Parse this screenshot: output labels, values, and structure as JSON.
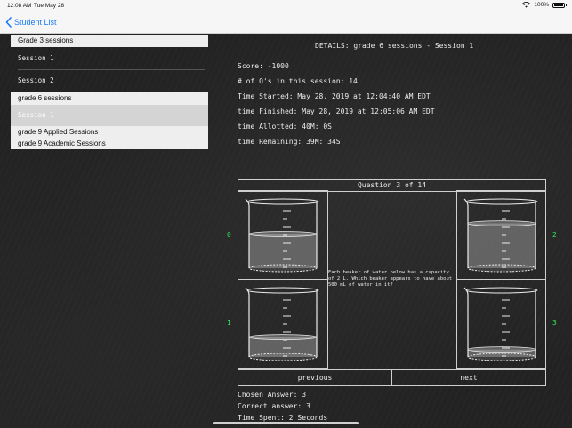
{
  "status": {
    "time": "12:08 AM",
    "date": "Tue May 28",
    "battery": "100%"
  },
  "nav": {
    "back_label": "Student List"
  },
  "sidebar": {
    "items": [
      {
        "label": "Grade 3 sessions",
        "style": "light"
      },
      {
        "label": "Session 1",
        "style": "chalk"
      },
      {
        "label": "Session 2",
        "style": "chalk"
      },
      {
        "label": "grade 6 sessions",
        "style": "light"
      },
      {
        "label": "Session 1",
        "style": "selected"
      },
      {
        "label": "grade 9 Applied Sessions",
        "style": "light"
      },
      {
        "label": "grade 9 Academic Sessions",
        "style": "light"
      }
    ]
  },
  "details": {
    "title": "DETAILS: grade 6 sessions - Session 1",
    "score": "Score: -1000",
    "num_questions": "# of Q's in this session: 14",
    "time_started": "Time Started: May 28, 2019 at 12:04:40 AM EDT",
    "time_finished": "time Finished: May 28, 2019 at 12:05:06 AM EDT",
    "time_allotted": "time Allotted: 40M: 0S",
    "time_remaining": "time Remaining: 39M: 34S"
  },
  "question": {
    "title": "Question 3 of 14",
    "text": "Each beaker of water below has a capacity of 2 L. Which beaker appears to have about 500 mL of water in it?",
    "option_labels": [
      "0",
      "1",
      "2",
      "3"
    ],
    "option_levels": [
      0.55,
      0.32,
      0.72,
      0.12
    ],
    "previous_label": "previous",
    "next_label": "next"
  },
  "result": {
    "chosen": "Chosen Answer: 3",
    "correct": "Correct answer: 3",
    "time_spent": "Time Spent: 2 Seconds"
  },
  "colors": {
    "accent": "#1a7cf5",
    "answer_label": "#2ee85a",
    "chalk": "#ececec"
  }
}
